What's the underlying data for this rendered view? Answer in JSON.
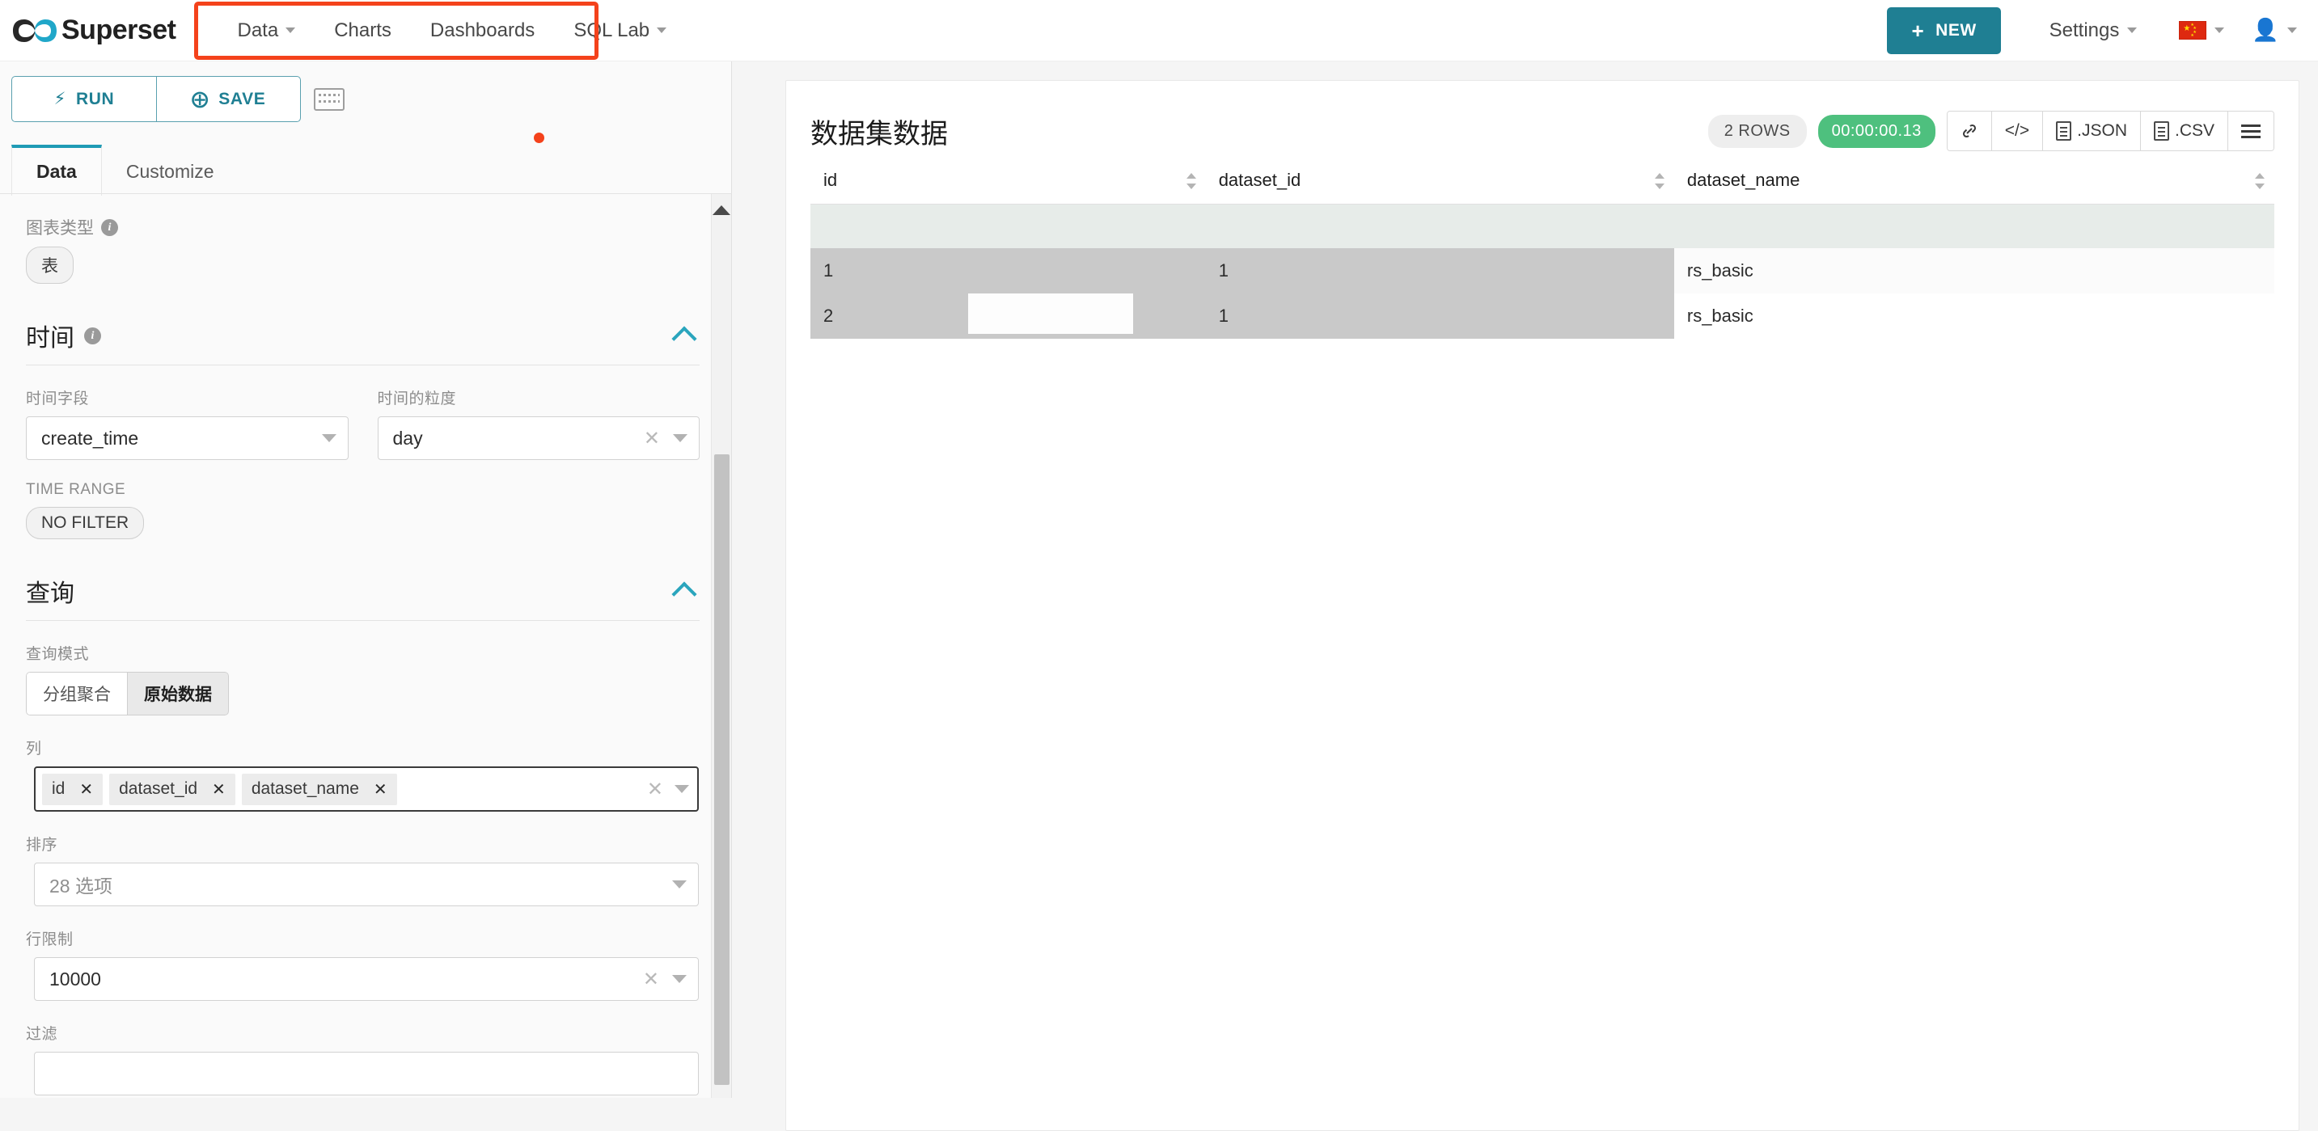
{
  "navbar": {
    "brand": "Superset",
    "brand_logo_icon": "infinity-logo-icon",
    "items": [
      {
        "label": "Data",
        "icon": "chevron-down-icon",
        "has_caret": true
      },
      {
        "label": "Charts",
        "has_caret": false
      },
      {
        "label": "Dashboards",
        "has_caret": false
      },
      {
        "label": "SQL Lab",
        "icon": "chevron-down-icon",
        "has_caret": true
      }
    ],
    "new_button": {
      "label": "NEW",
      "icon": "plus-icon"
    },
    "settings": {
      "label": "Settings",
      "icon": "chevron-down-icon"
    },
    "language": {
      "icon": "china-flag-icon",
      "caret": "chevron-down-icon"
    },
    "user": {
      "icon": "user-icon",
      "caret": "chevron-down-icon"
    },
    "highlight_color": "#f4421b",
    "accent_color": "#1f7f93"
  },
  "panel": {
    "run_button": {
      "label": "RUN",
      "icon": "bolt-icon"
    },
    "save_button": {
      "label": "SAVE",
      "icon": "plus-circle-icon"
    },
    "keyboard_button": {
      "icon": "keyboard-icon"
    },
    "tabs": [
      {
        "label": "Data",
        "active": true
      },
      {
        "label": "Customize",
        "active": false
      }
    ],
    "viz_type": {
      "label": "图表类型",
      "info_icon": "info-icon",
      "value": "表"
    },
    "time_section": {
      "title": "时间",
      "info_icon": "info-icon",
      "collapse_icon": "chevron-up-icon",
      "time_column": {
        "label": "时间字段",
        "value": "create_time"
      },
      "time_grain": {
        "label": "时间的粒度",
        "value": "day"
      },
      "time_range": {
        "label": "TIME RANGE",
        "value": "NO FILTER"
      }
    },
    "query_section": {
      "title": "查询",
      "collapse_icon": "chevron-up-icon",
      "query_mode": {
        "label": "查询模式",
        "options": [
          {
            "label": "分组聚合",
            "active": false
          },
          {
            "label": "原始数据",
            "active": true
          }
        ]
      },
      "columns": {
        "label": "列",
        "chips": [
          "id",
          "dataset_id",
          "dataset_name"
        ],
        "clear_icon": "close-icon",
        "caret_icon": "chevron-down-icon"
      },
      "ordering": {
        "label": "排序",
        "value": "28 选项"
      },
      "row_limit": {
        "label": "行限制",
        "value": "10000"
      },
      "filters": {
        "label": "过滤",
        "value": ""
      }
    },
    "scrollbar": {
      "up_icon": "arrow-up-icon"
    }
  },
  "results": {
    "title": "数据集数据",
    "rows_badge": "2 ROWS",
    "time_badge": "00:00:00.13",
    "time_badge_color": "#4ec07e",
    "tools": [
      {
        "name": "link-icon",
        "label": ""
      },
      {
        "name": "code-icon",
        "label": "</>"
      },
      {
        "name": "json-download-icon",
        "label": ".JSON"
      },
      {
        "name": "csv-download-icon",
        "label": ".CSV"
      },
      {
        "name": "menu-icon",
        "label": ""
      }
    ]
  },
  "chart_data": {
    "type": "table",
    "title": "数据集数据",
    "columns": [
      "id",
      "dataset_id",
      "dataset_name"
    ],
    "rows": [
      {
        "id": "1",
        "dataset_id": "1",
        "dataset_name": "rs_basic"
      },
      {
        "id": "2",
        "dataset_id": "1",
        "dataset_name": "rs_basic"
      }
    ],
    "row_count": 2,
    "sortable_columns": [
      "id",
      "dataset_id",
      "dataset_name"
    ]
  }
}
